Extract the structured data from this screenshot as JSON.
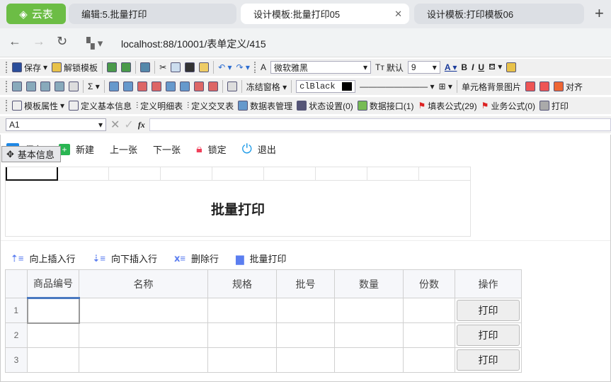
{
  "browser": {
    "logo": "云表",
    "tabs": [
      "编辑:5.批量打印",
      "设计模板:批量打印05",
      "设计模板:打印模板06"
    ],
    "url": "localhost:88/10001/表单定义/415"
  },
  "toolbar1": {
    "save": "保存",
    "unlock": "解锁模板",
    "font": "微软雅黑",
    "default": "默认",
    "size": "9",
    "bold": "B",
    "italic": "I",
    "underline": "U"
  },
  "toolbar2": {
    "freeze": "冻结窗格",
    "color": "clBlack",
    "cell_bg": "单元格背景图片",
    "align": "对齐"
  },
  "toolbar3": {
    "items": [
      "模板属性",
      "定义基本信息",
      "定义明细表",
      "定义交叉表",
      "数据表管理",
      "状态设置(0)",
      "数据接口(1)",
      "填表公式(29)",
      "业务公式(0)",
      "打印"
    ]
  },
  "formula": {
    "cell": "A1",
    "fx": "fx"
  },
  "form_toolbar": {
    "save": "保存",
    "new": "新建",
    "prev": "上一张",
    "next": "下一张",
    "lock": "锁定",
    "exit": "退出",
    "badge": "基本信息"
  },
  "sheet": {
    "title": "批量打印"
  },
  "detail": {
    "actions": [
      "向上插入行",
      "向下插入行",
      "删除行",
      "批量打印"
    ],
    "columns": [
      "商品编号",
      "名称",
      "规格",
      "批号",
      "数量",
      "份数",
      "操作"
    ],
    "rows": [
      "1",
      "2",
      "3"
    ],
    "print_label": "打印"
  }
}
